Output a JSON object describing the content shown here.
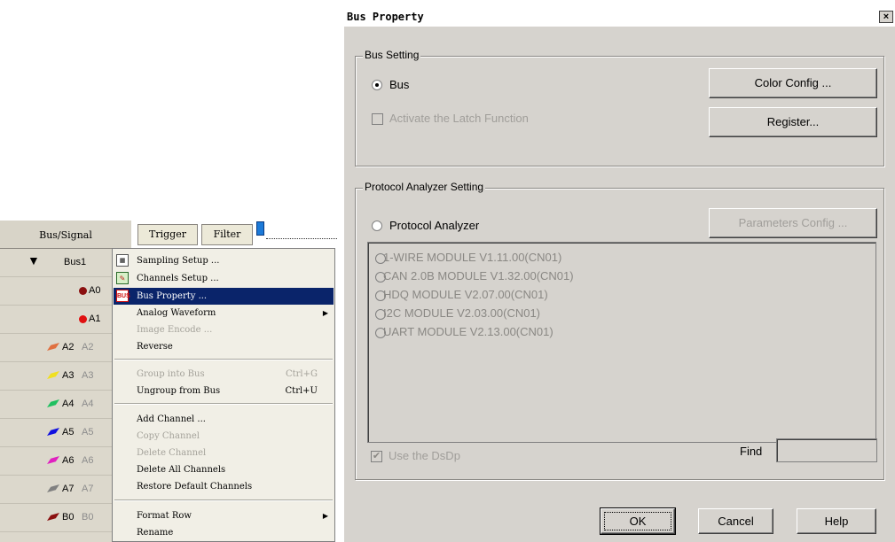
{
  "panel": {
    "header": "Bus/Signal",
    "trigger_label": "Trigger",
    "filter_label": "Filter",
    "rows": [
      {
        "label": "Bus1",
        "alias": "",
        "kind": "bus",
        "color": "#000000"
      },
      {
        "label": "A0",
        "alias": "",
        "kind": "dot",
        "color": "#8b1010"
      },
      {
        "label": "A1",
        "alias": "",
        "kind": "dot",
        "color": "#e01010"
      },
      {
        "label": "A2",
        "alias": "A2",
        "kind": "pen",
        "color": "#e07040"
      },
      {
        "label": "A3",
        "alias": "A3",
        "kind": "pen",
        "color": "#f0e020"
      },
      {
        "label": "A4",
        "alias": "A4",
        "kind": "pen",
        "color": "#20c060"
      },
      {
        "label": "A5",
        "alias": "A5",
        "kind": "pen",
        "color": "#1010e0"
      },
      {
        "label": "A6",
        "alias": "A6",
        "kind": "pen",
        "color": "#e020c0"
      },
      {
        "label": "A7",
        "alias": "A7",
        "kind": "pen",
        "color": "#808080"
      },
      {
        "label": "B0",
        "alias": "B0",
        "kind": "pen",
        "color": "#8b1010"
      }
    ]
  },
  "context_menu": {
    "items": [
      {
        "label": "Sampling Setup ...",
        "icon": "sampling-icon",
        "enabled": true
      },
      {
        "label": "Channels Setup ...",
        "icon": "channels-icon",
        "enabled": true
      },
      {
        "label": "Bus Property ...",
        "icon": "bus-icon",
        "enabled": true,
        "selected": true
      },
      {
        "label": "Analog Waveform",
        "enabled": true,
        "submenu": true
      },
      {
        "label": "Image Encode ...",
        "enabled": false
      },
      {
        "label": "Reverse",
        "enabled": true
      },
      {
        "label": "Group into Bus",
        "shortcut": "Ctrl+G",
        "enabled": false
      },
      {
        "label": "Ungroup from Bus",
        "shortcut": "Ctrl+U",
        "enabled": true
      },
      {
        "label": "Add Channel ...",
        "enabled": true
      },
      {
        "label": "Copy Channel",
        "enabled": false
      },
      {
        "label": "Delete Channel",
        "enabled": false
      },
      {
        "label": "Delete All Channels",
        "enabled": true
      },
      {
        "label": "Restore Default Channels",
        "enabled": true
      },
      {
        "label": "Format Row",
        "enabled": true,
        "submenu": true
      },
      {
        "label": "Rename",
        "enabled": true
      }
    ],
    "bus_icon_text": "BUS"
  },
  "dialog": {
    "title": "Bus Property",
    "close_glyph": "×",
    "bus_setting": {
      "legend": "Bus Setting",
      "bus_radio_label": "Bus",
      "bus_selected": true,
      "latch_label": "Activate the Latch Function",
      "latch_checked": false,
      "color_config_label": "Color Config ...",
      "register_label": "Register..."
    },
    "protocol": {
      "legend": "Protocol Analyzer Setting",
      "radio_label": "Protocol Analyzer",
      "radio_selected": false,
      "params_label": "Parameters Config ...",
      "modules": [
        "1-WIRE MODULE V1.11.00(CN01)",
        "CAN 2.0B MODULE V1.32.00(CN01)",
        "HDQ MODULE V2.07.00(CN01)",
        "I2C MODULE V2.03.00(CN01)",
        "UART MODULE V2.13.00(CN01)"
      ],
      "dsdp_label": "Use the DsDp",
      "dsdp_checked": true,
      "find_label": "Find",
      "find_value": ""
    },
    "ok_label": "OK",
    "cancel_label": "Cancel",
    "help_label": "Help"
  }
}
